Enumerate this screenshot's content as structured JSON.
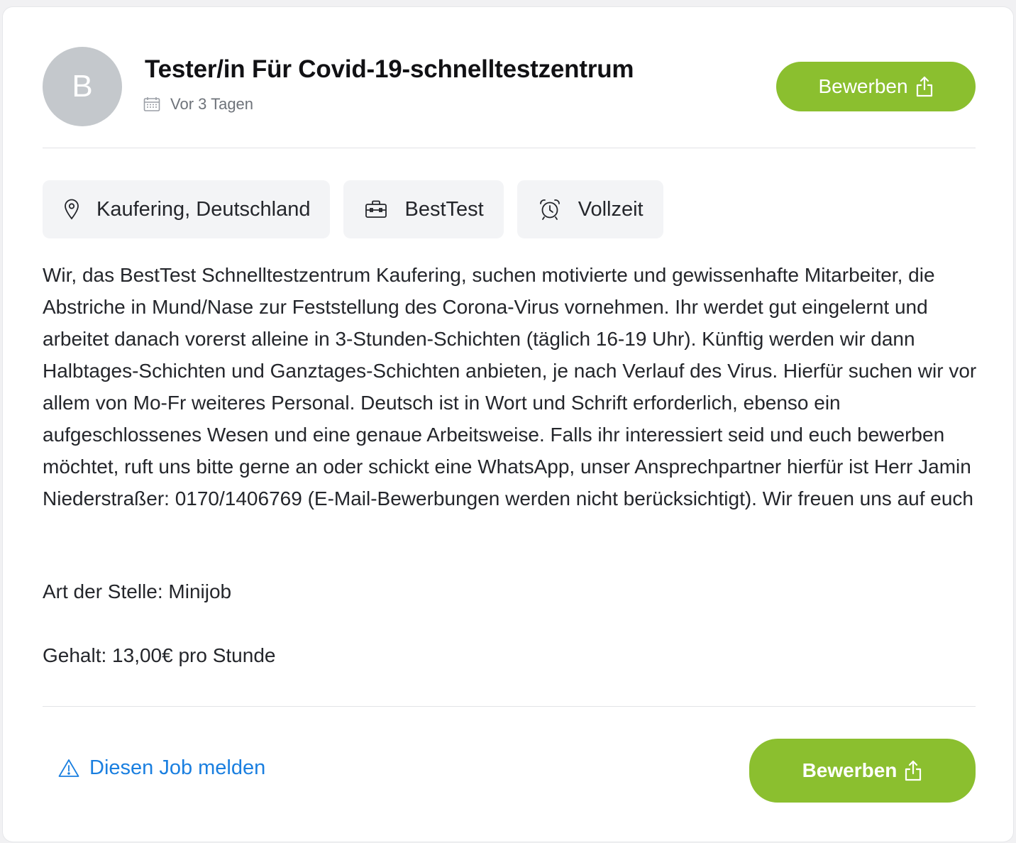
{
  "job": {
    "avatar_letter": "B",
    "title": "Tester/in Für Covid-19-schnelltestzentrum",
    "posted": "Vor 3 Tagen",
    "apply_label": "Bewerben",
    "tags": {
      "location": "Kaufering, Deutschland",
      "company": "BestTest",
      "employment_type": "Vollzeit"
    },
    "description": "Wir, das BestTest Schnelltestzentrum Kaufering, suchen motivierte und gewissenhafte Mitarbeiter, die Abstriche in Mund/Nase zur Feststellung des Corona-Virus vornehmen. Ihr werdet gut eingelernt und arbeitet danach vorerst alleine in 3-Stunden-Schichten (täglich 16-19 Uhr). Künftig werden wir dann Halbtages-Schichten und Ganztages-Schichten anbieten, je nach Verlauf des Virus. Hierfür suchen wir vor allem von Mo-Fr weiteres Personal. Deutsch ist in Wort und Schrift erforderlich, ebenso ein aufgeschlossenes Wesen und eine genaue Arbeitsweise. Falls ihr interessiert seid und euch bewerben möchtet, ruft uns bitte gerne an oder schickt eine WhatsApp, unser Ansprechpartner hierfür ist Herr Jamin Niederstraßer: 0170/1406769 (E-Mail-Bewerbungen werden nicht berücksichtigt). Wir freuen uns auf euch",
    "job_type": "Art der Stelle: Minijob",
    "salary": "Gehalt: 13,00€ pro Stunde"
  },
  "footer": {
    "report_label": "Diesen Job melden",
    "apply_label": "Bewerben"
  },
  "colors": {
    "accent_green": "#8bbf2f",
    "link_blue": "#1a7fe0",
    "avatar_gray": "#c4c8cc",
    "chip_bg": "#f3f4f6"
  },
  "icons": {
    "date": "calendar-icon",
    "apply": "share-upload-icon",
    "location": "map-pin-icon",
    "company": "briefcase-icon",
    "employment_type": "alarm-clock-icon",
    "report": "warning-triangle-icon"
  }
}
